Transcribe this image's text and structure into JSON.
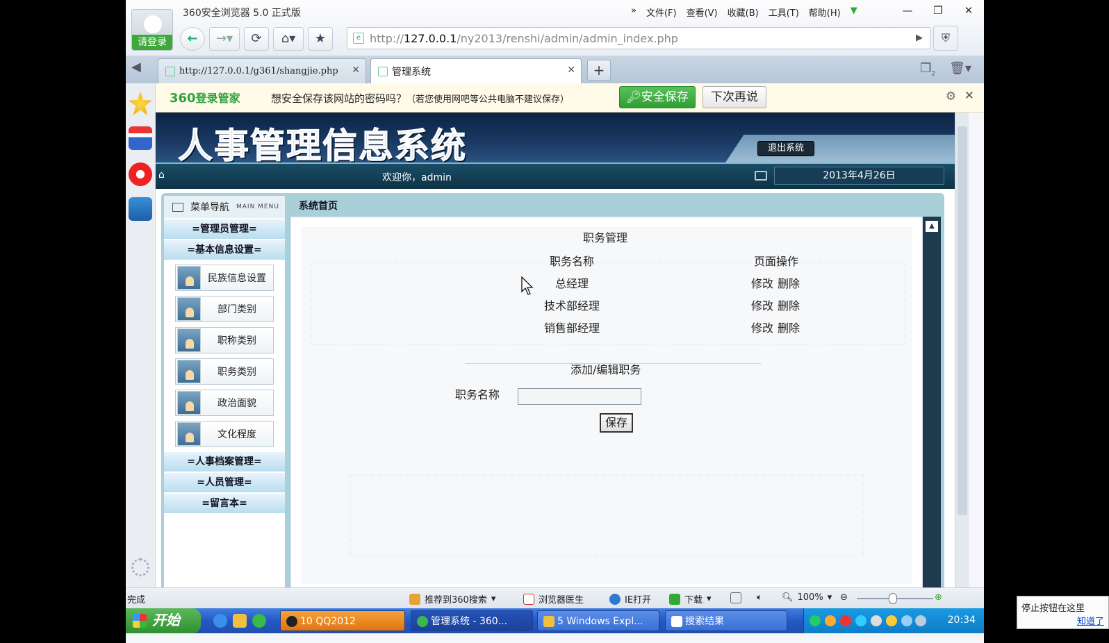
{
  "browser": {
    "login_label": "请登录",
    "app_title": "360安全浏览器 5.0 正式版",
    "menu": [
      "文件(F)",
      "查看(V)",
      "收藏(B)",
      "工具(T)",
      "帮助(H)"
    ],
    "menu_overflow": "»",
    "address_prefix": "http://",
    "address_host": "127.0.0.1",
    "address_path": "/ny2013/renshi/admin/admin_index.php",
    "tabs": [
      {
        "label": "http://127.0.0.1/g361/shangjie.php"
      },
      {
        "label": "管理系统"
      }
    ],
    "tab_count_badge": "2"
  },
  "password_bar": {
    "brand": "360",
    "brand_suffix": "登录管家",
    "message": "想安全保存该网站的密码吗？",
    "note": "（若您使用网吧等公共电脑不建议保存）",
    "save_label": "安全保存",
    "later_label": "下次再说"
  },
  "site": {
    "title": "人事管理信息系统",
    "logout_label": "退出系统",
    "welcome": "欢迎你，admin",
    "date": "2013年4月26日",
    "menu_head": "菜单导航",
    "menu_head_en": "MAIN MENU",
    "groups": [
      "=管理员管理=",
      "=基本信息设置=",
      "=人事档案管理=",
      "=人员管理=",
      "=留言本="
    ],
    "items": [
      "民族信息设置",
      "部门类别",
      "职称类别",
      "职务类别",
      "政治面貌",
      "文化程度"
    ],
    "main_title": "系统首页"
  },
  "content": {
    "section_title": "职务管理",
    "col_name": "职务名称",
    "col_ops": "页面操作",
    "rows": [
      {
        "name": "总经理",
        "edit": "修改",
        "del": "删除"
      },
      {
        "name": "技术部经理",
        "edit": "修改",
        "del": "删除"
      },
      {
        "name": "销售部经理",
        "edit": "修改",
        "del": "删除"
      }
    ],
    "form_title": "添加/编辑职务",
    "field_label": "职务名称",
    "field_value": "",
    "save_label": "保存"
  },
  "statusbar": {
    "status": "完成",
    "recommend": "推荐到360搜索",
    "doctor": "浏览器医生",
    "ie_open": "IE打开",
    "download": "下载",
    "zoom": "100%"
  },
  "taskbar": {
    "start": "开始",
    "tasks": [
      "10 QQ2012",
      "管理系统 - 360...",
      "5 Windows Expl...",
      "搜索结果"
    ],
    "clock": "20:34"
  },
  "toast": {
    "text": "停止按钮在这里",
    "link": "知道了"
  },
  "colors": {
    "accent_green": "#2fa33a",
    "banner_navy": "#0c2242",
    "frame_teal": "#a9cfd8",
    "taskbar_blue": "#2558c4"
  }
}
